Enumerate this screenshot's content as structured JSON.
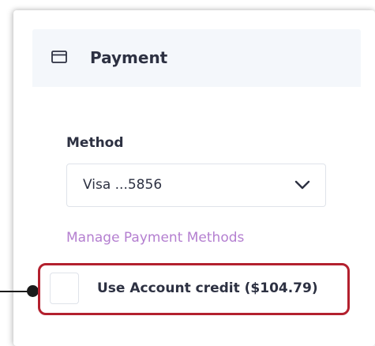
{
  "payment": {
    "header_title": "Payment",
    "header_icon": "credit-card-icon",
    "method_label": "Method",
    "method_value": "Visa ...5856",
    "manage_link": "Manage Payment Methods",
    "credit_checkbox_checked": false,
    "credit_label": "Use Account credit ($104.79)"
  },
  "colors": {
    "link": "#b47fd0",
    "highlight": "#b3202e",
    "header_bg": "#f4f7fb",
    "text": "#2d3142"
  }
}
